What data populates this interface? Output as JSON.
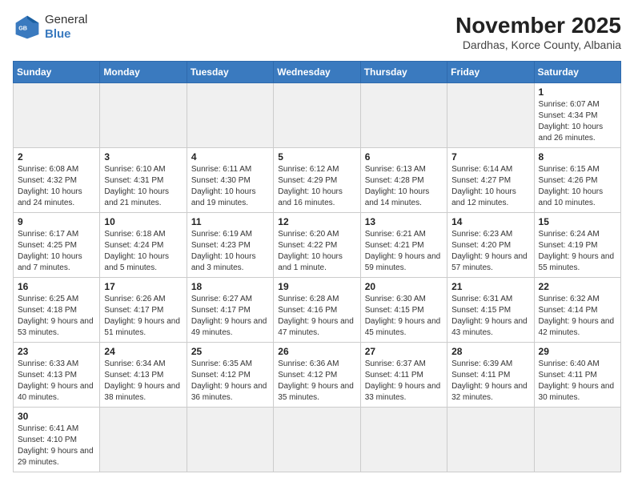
{
  "header": {
    "logo_line1": "General",
    "logo_line2": "Blue",
    "month_year": "November 2025",
    "location": "Dardhas, Korce County, Albania"
  },
  "days_of_week": [
    "Sunday",
    "Monday",
    "Tuesday",
    "Wednesday",
    "Thursday",
    "Friday",
    "Saturday"
  ],
  "weeks": [
    [
      {
        "day": "",
        "info": ""
      },
      {
        "day": "",
        "info": ""
      },
      {
        "day": "",
        "info": ""
      },
      {
        "day": "",
        "info": ""
      },
      {
        "day": "",
        "info": ""
      },
      {
        "day": "",
        "info": ""
      },
      {
        "day": "1",
        "info": "Sunrise: 6:07 AM\nSunset: 4:34 PM\nDaylight: 10 hours and 26 minutes."
      }
    ],
    [
      {
        "day": "2",
        "info": "Sunrise: 6:08 AM\nSunset: 4:32 PM\nDaylight: 10 hours and 24 minutes."
      },
      {
        "day": "3",
        "info": "Sunrise: 6:10 AM\nSunset: 4:31 PM\nDaylight: 10 hours and 21 minutes."
      },
      {
        "day": "4",
        "info": "Sunrise: 6:11 AM\nSunset: 4:30 PM\nDaylight: 10 hours and 19 minutes."
      },
      {
        "day": "5",
        "info": "Sunrise: 6:12 AM\nSunset: 4:29 PM\nDaylight: 10 hours and 16 minutes."
      },
      {
        "day": "6",
        "info": "Sunrise: 6:13 AM\nSunset: 4:28 PM\nDaylight: 10 hours and 14 minutes."
      },
      {
        "day": "7",
        "info": "Sunrise: 6:14 AM\nSunset: 4:27 PM\nDaylight: 10 hours and 12 minutes."
      },
      {
        "day": "8",
        "info": "Sunrise: 6:15 AM\nSunset: 4:26 PM\nDaylight: 10 hours and 10 minutes."
      }
    ],
    [
      {
        "day": "9",
        "info": "Sunrise: 6:17 AM\nSunset: 4:25 PM\nDaylight: 10 hours and 7 minutes."
      },
      {
        "day": "10",
        "info": "Sunrise: 6:18 AM\nSunset: 4:24 PM\nDaylight: 10 hours and 5 minutes."
      },
      {
        "day": "11",
        "info": "Sunrise: 6:19 AM\nSunset: 4:23 PM\nDaylight: 10 hours and 3 minutes."
      },
      {
        "day": "12",
        "info": "Sunrise: 6:20 AM\nSunset: 4:22 PM\nDaylight: 10 hours and 1 minute."
      },
      {
        "day": "13",
        "info": "Sunrise: 6:21 AM\nSunset: 4:21 PM\nDaylight: 9 hours and 59 minutes."
      },
      {
        "day": "14",
        "info": "Sunrise: 6:23 AM\nSunset: 4:20 PM\nDaylight: 9 hours and 57 minutes."
      },
      {
        "day": "15",
        "info": "Sunrise: 6:24 AM\nSunset: 4:19 PM\nDaylight: 9 hours and 55 minutes."
      }
    ],
    [
      {
        "day": "16",
        "info": "Sunrise: 6:25 AM\nSunset: 4:18 PM\nDaylight: 9 hours and 53 minutes."
      },
      {
        "day": "17",
        "info": "Sunrise: 6:26 AM\nSunset: 4:17 PM\nDaylight: 9 hours and 51 minutes."
      },
      {
        "day": "18",
        "info": "Sunrise: 6:27 AM\nSunset: 4:17 PM\nDaylight: 9 hours and 49 minutes."
      },
      {
        "day": "19",
        "info": "Sunrise: 6:28 AM\nSunset: 4:16 PM\nDaylight: 9 hours and 47 minutes."
      },
      {
        "day": "20",
        "info": "Sunrise: 6:30 AM\nSunset: 4:15 PM\nDaylight: 9 hours and 45 minutes."
      },
      {
        "day": "21",
        "info": "Sunrise: 6:31 AM\nSunset: 4:15 PM\nDaylight: 9 hours and 43 minutes."
      },
      {
        "day": "22",
        "info": "Sunrise: 6:32 AM\nSunset: 4:14 PM\nDaylight: 9 hours and 42 minutes."
      }
    ],
    [
      {
        "day": "23",
        "info": "Sunrise: 6:33 AM\nSunset: 4:13 PM\nDaylight: 9 hours and 40 minutes."
      },
      {
        "day": "24",
        "info": "Sunrise: 6:34 AM\nSunset: 4:13 PM\nDaylight: 9 hours and 38 minutes."
      },
      {
        "day": "25",
        "info": "Sunrise: 6:35 AM\nSunset: 4:12 PM\nDaylight: 9 hours and 36 minutes."
      },
      {
        "day": "26",
        "info": "Sunrise: 6:36 AM\nSunset: 4:12 PM\nDaylight: 9 hours and 35 minutes."
      },
      {
        "day": "27",
        "info": "Sunrise: 6:37 AM\nSunset: 4:11 PM\nDaylight: 9 hours and 33 minutes."
      },
      {
        "day": "28",
        "info": "Sunrise: 6:39 AM\nSunset: 4:11 PM\nDaylight: 9 hours and 32 minutes."
      },
      {
        "day": "29",
        "info": "Sunrise: 6:40 AM\nSunset: 4:11 PM\nDaylight: 9 hours and 30 minutes."
      }
    ],
    [
      {
        "day": "30",
        "info": "Sunrise: 6:41 AM\nSunset: 4:10 PM\nDaylight: 9 hours and 29 minutes."
      },
      {
        "day": "",
        "info": ""
      },
      {
        "day": "",
        "info": ""
      },
      {
        "day": "",
        "info": ""
      },
      {
        "day": "",
        "info": ""
      },
      {
        "day": "",
        "info": ""
      },
      {
        "day": "",
        "info": ""
      }
    ]
  ]
}
